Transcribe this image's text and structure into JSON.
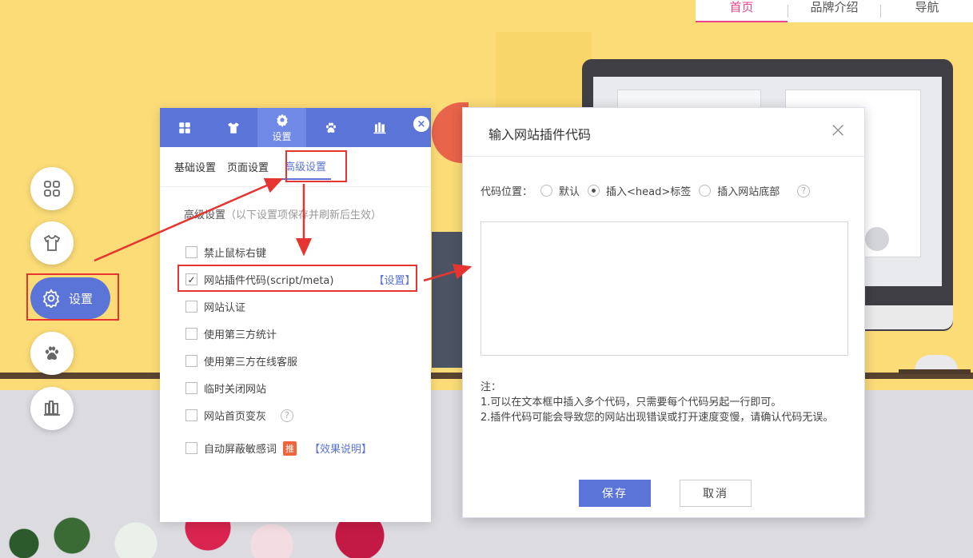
{
  "topnav": {
    "items": [
      {
        "label": "首页",
        "active": true
      },
      {
        "label": "品牌介绍",
        "active": false
      },
      {
        "label": "导航",
        "active": false
      }
    ]
  },
  "left_dock": {
    "items": [
      {
        "icon": "grid-icon"
      },
      {
        "icon": "shirt-icon"
      },
      {
        "icon": "gear-icon",
        "label": "设置",
        "active": true
      },
      {
        "icon": "paw-icon"
      },
      {
        "icon": "books-icon"
      }
    ]
  },
  "panel": {
    "tabs": [
      {
        "icon": "grid-icon",
        "label": ""
      },
      {
        "icon": "shirt-icon",
        "label": ""
      },
      {
        "icon": "gear-icon",
        "label": "设置",
        "active": true
      },
      {
        "icon": "paw-icon",
        "label": ""
      },
      {
        "icon": "books-icon",
        "label": ""
      }
    ],
    "close": "×",
    "subtabs": [
      {
        "label": "基础设置"
      },
      {
        "label": "页面设置"
      },
      {
        "label": "高级设置",
        "active": true
      }
    ],
    "section_title": "高级设置",
    "section_note": "（以下设置项保存并刷新后生效）",
    "options": [
      {
        "label": "禁止鼠标右键",
        "checked": false
      },
      {
        "label": "网站插件代码(script/meta)",
        "checked": true,
        "link": "【设置】"
      },
      {
        "label": "网站认证",
        "checked": false
      },
      {
        "label": "使用第三方统计",
        "checked": false
      },
      {
        "label": "使用第三方在线客服",
        "checked": false
      },
      {
        "label": "临时关闭网站",
        "checked": false
      },
      {
        "label": "网站首页变灰",
        "checked": false,
        "help": "?"
      },
      {
        "label": "自动屏蔽敏感词",
        "checked": false,
        "badge": "推",
        "link": "【效果说明】"
      }
    ]
  },
  "dialog": {
    "title": "输入网站插件代码",
    "close": "×",
    "position_label": "代码位置：",
    "position_options": [
      {
        "label": "默认",
        "checked": false
      },
      {
        "label": "插入<head>标签",
        "checked": true
      },
      {
        "label": "插入网站底部",
        "checked": false
      }
    ],
    "help": "?",
    "code_value": "",
    "notes_title": "注：",
    "notes": [
      "1.可以在文本框中插入多个代码，只需要每个代码另起一行即可。",
      "2.插件代码可能会导致您的网站出现错误或打开速度变慢，请确认代码无误。"
    ],
    "save_label": "保存",
    "cancel_label": "取消"
  },
  "colors": {
    "accent": "#5a74d8",
    "nav_active": "#e8468c",
    "annotation_red": "#e63530",
    "background_yellow": "#fbdc77"
  }
}
